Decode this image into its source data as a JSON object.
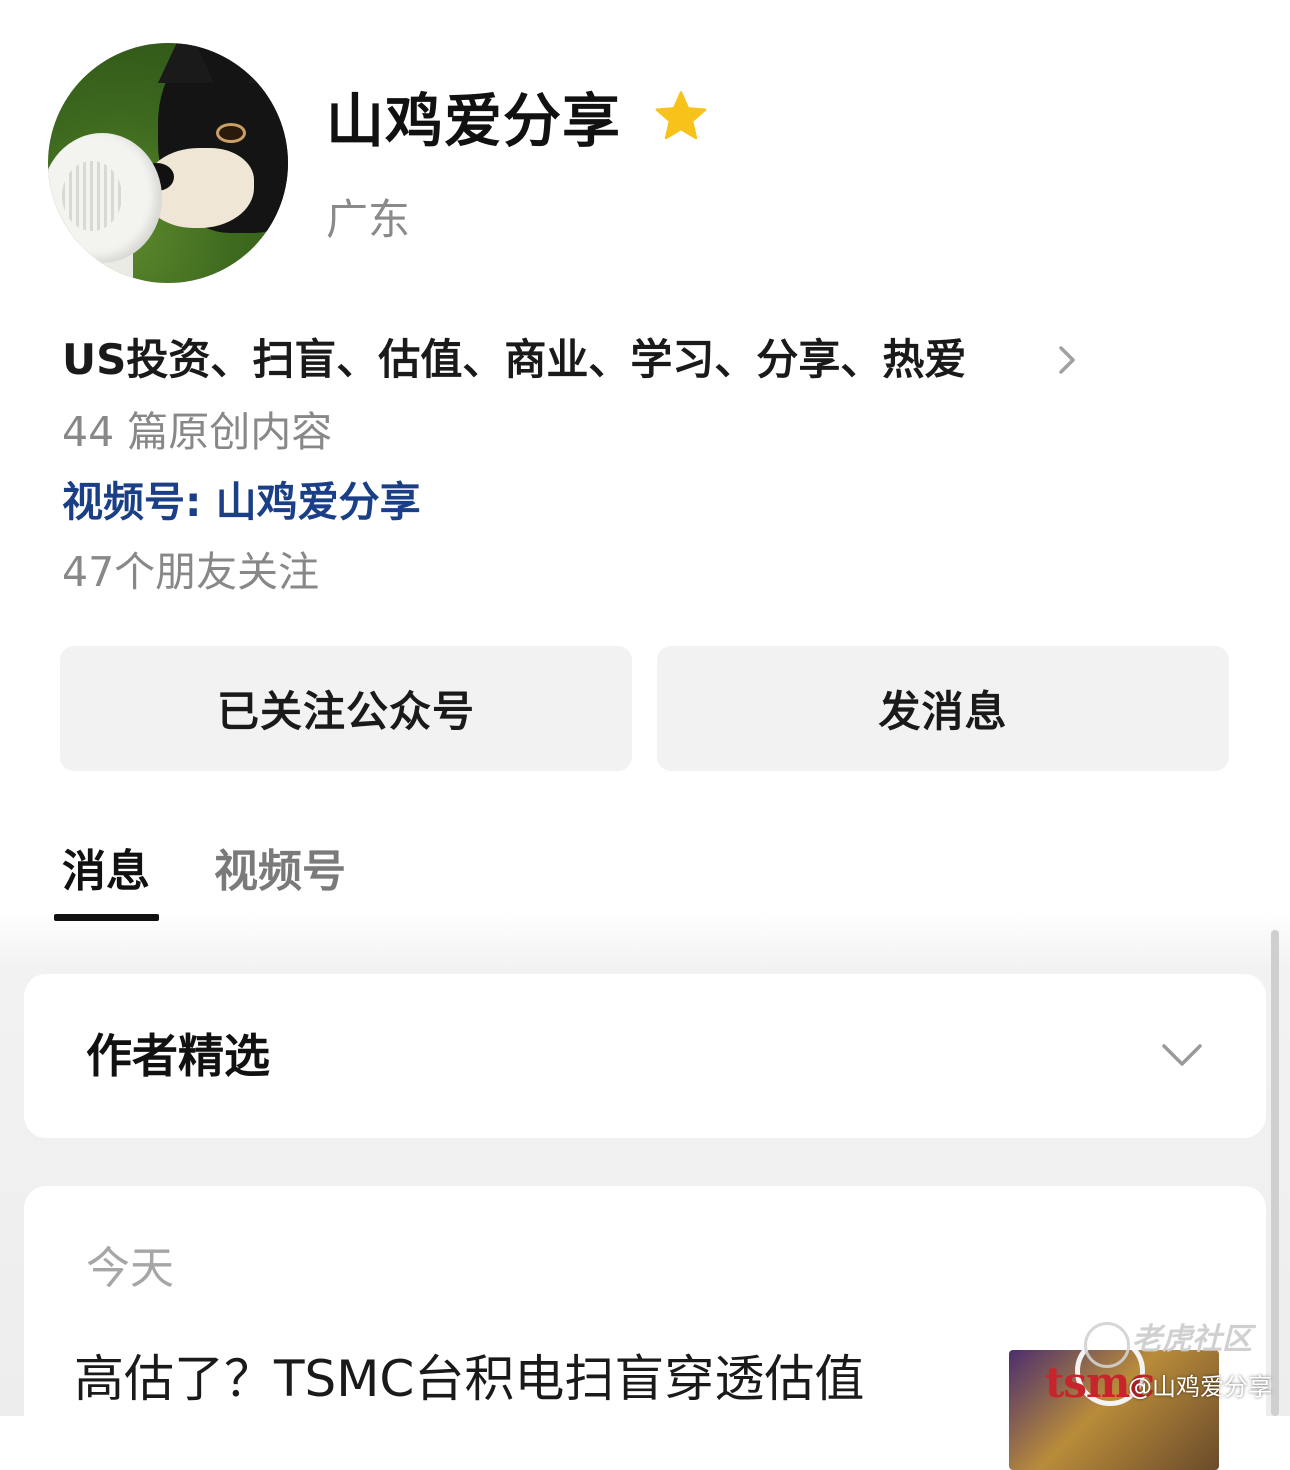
{
  "profile": {
    "name": "山鸡爱分享",
    "region": "广东",
    "bio": "US投资、扫盲、估值、商业、学习、分享、热爱",
    "original_count": "44 篇原创内容",
    "channel_link": "视频号: 山鸡爱分享",
    "friends_following": "47个朋友关注",
    "star_color": "#f7c31a"
  },
  "actions": {
    "follow_label": "已关注公众号",
    "message_label": "发消息"
  },
  "tabs": [
    {
      "label": "消息",
      "active": true
    },
    {
      "label": "视频号",
      "active": false
    }
  ],
  "picks": {
    "title": "作者精选"
  },
  "feed": {
    "date_label": "今天",
    "article_title": "高估了？TSMC台积电扫盲穿透估值",
    "thumb_text": "tsmc"
  },
  "watermark": {
    "brand": "老虎社区",
    "handle": "@山鸡爱分享"
  },
  "colors": {
    "link_blue": "#1b3f86",
    "muted_gray": "#888888",
    "button_bg": "#f2f2f2"
  }
}
